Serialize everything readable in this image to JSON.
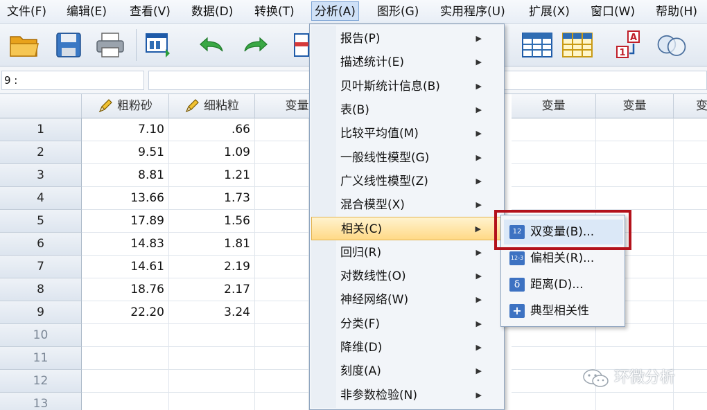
{
  "menubar": {
    "items": [
      {
        "label": "文件(F)"
      },
      {
        "label": "编辑(E)"
      },
      {
        "label": "查看(V)"
      },
      {
        "label": "数据(D)"
      },
      {
        "label": "转换(T)"
      },
      {
        "label": "分析(A)"
      },
      {
        "label": "图形(G)"
      },
      {
        "label": "实用程序(U)"
      },
      {
        "label": "扩展(X)"
      },
      {
        "label": "窗口(W)"
      },
      {
        "label": "帮助(H)"
      }
    ],
    "active_index": 5
  },
  "toolbar": {
    "buttons": [
      "open-icon",
      "save-icon",
      "print-icon",
      "dialog-recall-icon",
      "undo-icon",
      "redo-icon",
      "goto-case-icon",
      "split-file-icon",
      "select-cases-icon",
      "value-labels-icon",
      "use-sets-icon"
    ]
  },
  "refbar": {
    "label": "9 :",
    "value": ""
  },
  "grid": {
    "columns": [
      "粗粉砂",
      "细粘粒",
      "变量",
      "变量",
      "变量",
      "变"
    ],
    "rows": [
      {
        "num": "1",
        "a": "7.10",
        "b": ".66"
      },
      {
        "num": "2",
        "a": "9.51",
        "b": "1.09"
      },
      {
        "num": "3",
        "a": "8.81",
        "b": "1.21"
      },
      {
        "num": "4",
        "a": "13.66",
        "b": "1.73"
      },
      {
        "num": "5",
        "a": "17.89",
        "b": "1.56"
      },
      {
        "num": "6",
        "a": "14.83",
        "b": "1.81"
      },
      {
        "num": "7",
        "a": "14.61",
        "b": "2.19"
      },
      {
        "num": "8",
        "a": "18.76",
        "b": "2.17"
      },
      {
        "num": "9",
        "a": "22.20",
        "b": "3.24"
      },
      {
        "num": "10",
        "a": "",
        "b": ""
      },
      {
        "num": "11",
        "a": "",
        "b": ""
      },
      {
        "num": "12",
        "a": "",
        "b": ""
      },
      {
        "num": "13",
        "a": "",
        "b": ""
      }
    ]
  },
  "analyze_menu": {
    "items": [
      {
        "label": "报告(P)"
      },
      {
        "label": "描述统计(E)"
      },
      {
        "label": "贝叶斯统计信息(B)"
      },
      {
        "label": "表(B)"
      },
      {
        "label": "比较平均值(M)"
      },
      {
        "label": "一般线性模型(G)"
      },
      {
        "label": "广义线性模型(Z)"
      },
      {
        "label": "混合模型(X)"
      },
      {
        "label": "相关(C)"
      },
      {
        "label": "回归(R)"
      },
      {
        "label": "对数线性(O)"
      },
      {
        "label": "神经网络(W)"
      },
      {
        "label": "分类(F)"
      },
      {
        "label": "降维(D)"
      },
      {
        "label": "刻度(A)"
      },
      {
        "label": "非参数检验(N)"
      }
    ],
    "highlighted_index": 8
  },
  "correlate_submenu": {
    "items": [
      {
        "label": "双变量(B)...",
        "icon": "bivariate-icon",
        "icon_text": "12"
      },
      {
        "label": "偏相关(R)...",
        "icon": "partial-icon",
        "icon_text": "12-3"
      },
      {
        "label": "距离(D)...",
        "icon": "distance-icon",
        "icon_text": "δ"
      },
      {
        "label": "典型相关性",
        "icon": "canonical-icon",
        "icon_text": "+"
      }
    ]
  },
  "watermark": {
    "text": "环微分析"
  },
  "colors": {
    "highlight": "#ffd986",
    "frame": "#b3121b",
    "accent": "#2f6db3"
  }
}
